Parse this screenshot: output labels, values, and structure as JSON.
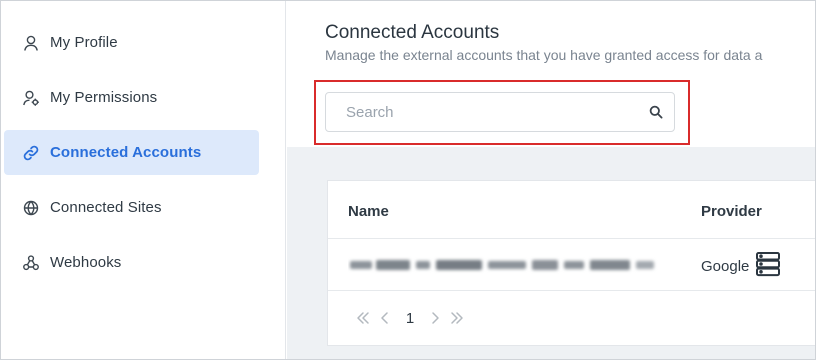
{
  "sidebar": {
    "items": [
      {
        "label": "My Profile",
        "icon": "user-icon",
        "active": false
      },
      {
        "label": "My Permissions",
        "icon": "user-settings-icon",
        "active": false
      },
      {
        "label": "Connected Accounts",
        "icon": "link-icon",
        "active": true
      },
      {
        "label": "Connected Sites",
        "icon": "globe-icon",
        "active": false
      },
      {
        "label": "Webhooks",
        "icon": "webhook-icon",
        "active": false
      }
    ]
  },
  "main": {
    "title": "Connected Accounts",
    "subtitle": "Manage the external accounts that you have granted access for data a",
    "search": {
      "placeholder": "Search",
      "value": ""
    },
    "table": {
      "columns": [
        "Name",
        "Provider"
      ],
      "rows": [
        {
          "provider": "Google",
          "provider_icon": "server-icon"
        }
      ]
    },
    "pagination": {
      "page": "1"
    }
  },
  "colors": {
    "accent": "#2a6fdb",
    "active_bg": "#dde9fb",
    "highlight": "#d92b2b",
    "content_bg": "#eef1f4"
  }
}
